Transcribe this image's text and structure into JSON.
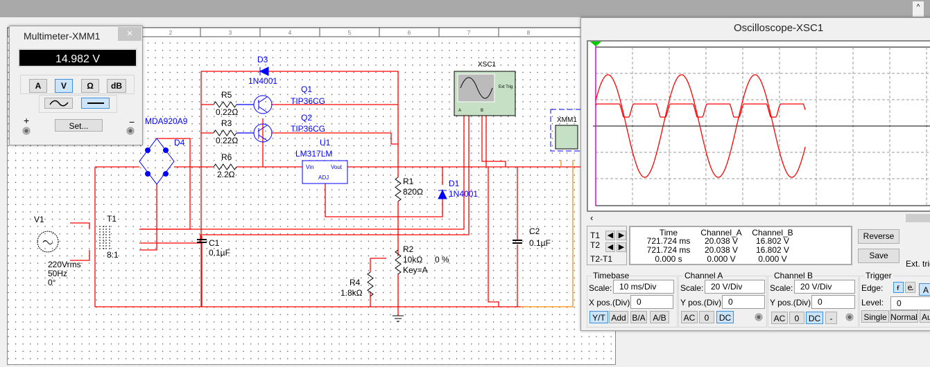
{
  "schematic": {
    "ruler": [
      "2",
      "3",
      "4",
      "5",
      "6",
      "7",
      "8"
    ],
    "components": [
      {
        "ref": "V1",
        "value": "220Vrms",
        "extra": [
          "50Hz",
          "0°"
        ]
      },
      {
        "ref": "T1",
        "value": "8:1"
      },
      {
        "ref": "D4",
        "value": "MDA920A9"
      },
      {
        "ref": "D3",
        "value": "1N4001"
      },
      {
        "ref": "R5",
        "value": "0.22Ω"
      },
      {
        "ref": "R3",
        "value": "0.22Ω"
      },
      {
        "ref": "R6",
        "value": "2.2Ω"
      },
      {
        "ref": "Q1",
        "value": "TIP36CG"
      },
      {
        "ref": "Q2",
        "value": "TIP36CG"
      },
      {
        "ref": "U1",
        "value": "LM317LM",
        "pins": [
          "Vin",
          "Vout",
          "ADJ"
        ]
      },
      {
        "ref": "R1",
        "value": "820Ω"
      },
      {
        "ref": "D1",
        "value": "1N4001"
      },
      {
        "ref": "C1",
        "value": "0.1µF"
      },
      {
        "ref": "C2",
        "value": "0.1µF"
      },
      {
        "ref": "R2",
        "value": "10kΩ",
        "extra": [
          "Key=A",
          "0 %"
        ]
      },
      {
        "ref": "R4",
        "value": "1.8kΩ"
      },
      {
        "ref": "XSC1",
        "pins": [
          "A",
          "B",
          "Ext Trig"
        ]
      },
      {
        "ref": "XMM1"
      }
    ],
    "colors": {
      "wire": "#ff0000",
      "component": "#0000ff",
      "meter_wire": "#ff8c00",
      "instrument": "#c5e0c5"
    }
  },
  "multimeter": {
    "title": "Multimeter-XMM1",
    "close": "×",
    "reading": "14.982 V",
    "modes": [
      "A",
      "V",
      "Ω",
      "dB"
    ],
    "active_mode": "V",
    "coupling_active": "DC",
    "set_label": "Set...",
    "plus": "+",
    "minus": "−"
  },
  "oscilloscope": {
    "title": "Oscilloscope-XSC1",
    "cursor_table": {
      "headers": [
        "Time",
        "Channel_A",
        "Channel_B"
      ],
      "rows": [
        {
          "label": "T1",
          "values": [
            "721.724 ms",
            "20.038 V",
            "16.802 V"
          ]
        },
        {
          "label": "T2",
          "values": [
            "721.724 ms",
            "20.038 V",
            "16.802 V"
          ]
        },
        {
          "label": "T2-T1",
          "values": [
            "0.000 s",
            "0.000 V",
            "0.000 V"
          ]
        }
      ]
    },
    "reverse_label": "Reverse",
    "save_label": "Save",
    "ext_trig_label": "Ext. trig",
    "timebase": {
      "title": "Timebase",
      "scale_label": "Scale:",
      "scale": "10 ms/Div",
      "pos_label": "X pos.(Div):",
      "pos": "0",
      "modes": [
        "Y/T",
        "Add",
        "B/A",
        "A/B"
      ],
      "active": "Y/T"
    },
    "channel_a": {
      "title": "Channel A",
      "scale_label": "Scale:",
      "scale": "20  V/Div",
      "pos_label": "Y pos.(Div):",
      "pos": "0",
      "coupling": [
        "AC",
        "0",
        "DC"
      ],
      "active": "DC"
    },
    "channel_b": {
      "title": "Channel B",
      "scale_label": "Scale:",
      "scale": "20  V/Div",
      "pos_label": "Y pos.(Div):",
      "pos": "0",
      "coupling": [
        "AC",
        "0",
        "DC",
        "-"
      ],
      "active": "DC"
    },
    "trigger": {
      "title": "Trigger",
      "edge_label": "Edge:",
      "source": "A",
      "level_label": "Level:",
      "level": "0",
      "modes": [
        "Single",
        "Normal",
        "Auto"
      ]
    },
    "traces": {
      "color": "#ff0000",
      "time_per_div_ms": 10,
      "volts_per_div": 20,
      "channel_a": {
        "peak_v": 39,
        "frequency_hz": 50,
        "phase_deg": 30
      },
      "channel_b": {
        "regulated_v": 16.8,
        "min_v": 6.8
      },
      "duration_ms": 57
    }
  }
}
